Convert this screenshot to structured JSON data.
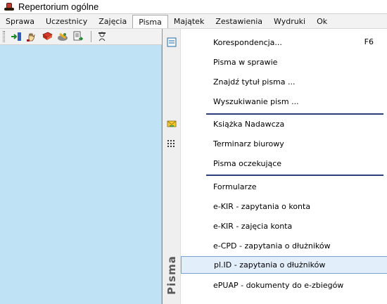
{
  "window": {
    "title": "Repertorium ogólne"
  },
  "menubar": {
    "items": [
      {
        "label": "Sprawa"
      },
      {
        "label": "Uczestnicy"
      },
      {
        "label": "Zajęcia"
      },
      {
        "label": "Pisma"
      },
      {
        "label": "Majątek"
      },
      {
        "label": "Zestawienia"
      },
      {
        "label": "Wydruki"
      },
      {
        "label": "Ok"
      }
    ],
    "active": "Pisma"
  },
  "toolbar": {
    "icons": [
      "arrow-in-icon",
      "hand-icon",
      "book-icon",
      "tools-icon",
      "document-export-icon",
      "user-search-icon"
    ]
  },
  "dropdown": {
    "side_label": "Pisma",
    "items": [
      {
        "label": "Korespondencja...",
        "shortcut": "F6",
        "icon": "document-icon"
      },
      {
        "label": "Pisma w sprawie"
      },
      {
        "label": "Znajdź tytuł pisma ..."
      },
      {
        "label": "Wyszukiwanie pism ..."
      },
      {
        "label": "Książka Nadawcza",
        "icon": "envelope-icon"
      },
      {
        "label": "Terminarz biurowy",
        "icon": "calendar-grid-icon"
      },
      {
        "label": "Pisma oczekujące"
      },
      {
        "label": "Formularze"
      },
      {
        "label": "e-KIR - zapytania o konta"
      },
      {
        "label": "e-KIR - zajęcia konta"
      },
      {
        "label": "e-CPD - zapytania o dłużników"
      },
      {
        "label": "pl.ID - zapytania o dłużników",
        "highlighted": true
      },
      {
        "label": "ePUAP - dokumenty do e-zbiegów"
      }
    ]
  },
  "colors": {
    "workspace": "#bfe3f5",
    "highlight_bg": "#e3eefb",
    "highlight_border": "#7aa0d4",
    "separator": "#2d3f7a"
  }
}
